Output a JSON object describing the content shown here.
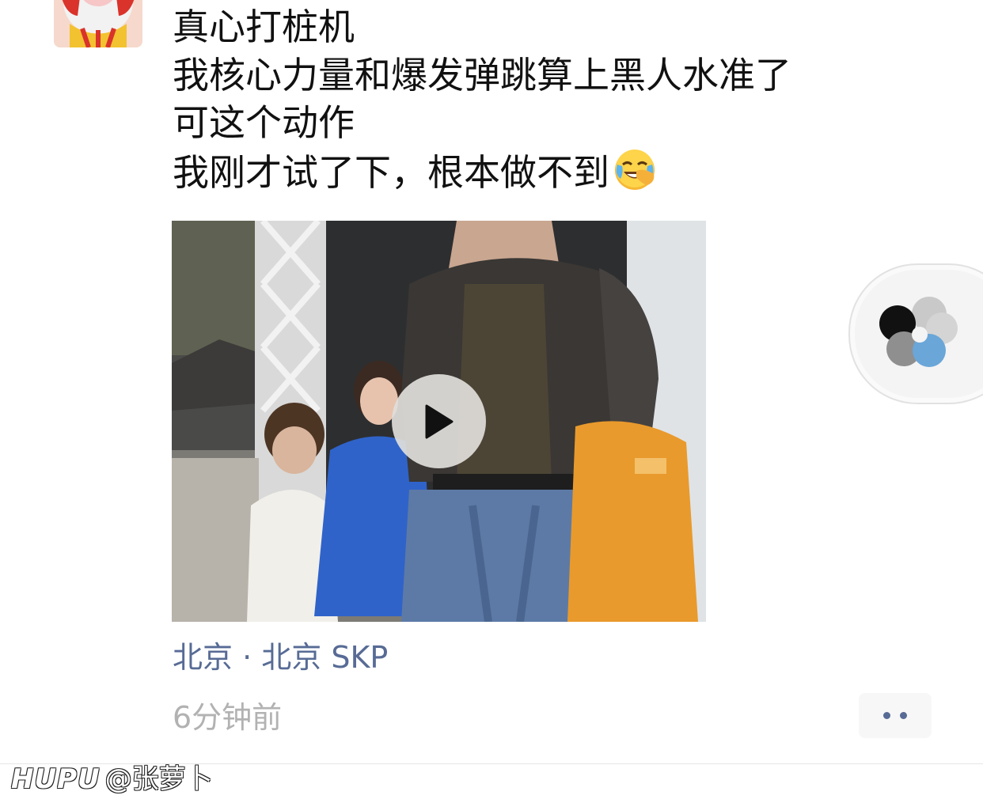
{
  "post": {
    "lines": [
      "真心打桩机",
      "我核心力量和爆发弹跳算上黑人水准了",
      "可这个动作",
      "我刚才试了下，根本做不到"
    ],
    "emoji_icon": "crying-laughing-emoji"
  },
  "video": {
    "play_icon": "play-icon"
  },
  "location": "北京 · 北京 SKP",
  "timestamp": "6分钟前",
  "more_icon": "more-dots-icon",
  "floating_icon": "mini-program-icon",
  "watermark": {
    "brand": "HUPU",
    "user": "@张萝卜"
  },
  "colors": {
    "link": "#576b95",
    "meta": "#b2b2b2",
    "text": "#111111"
  }
}
